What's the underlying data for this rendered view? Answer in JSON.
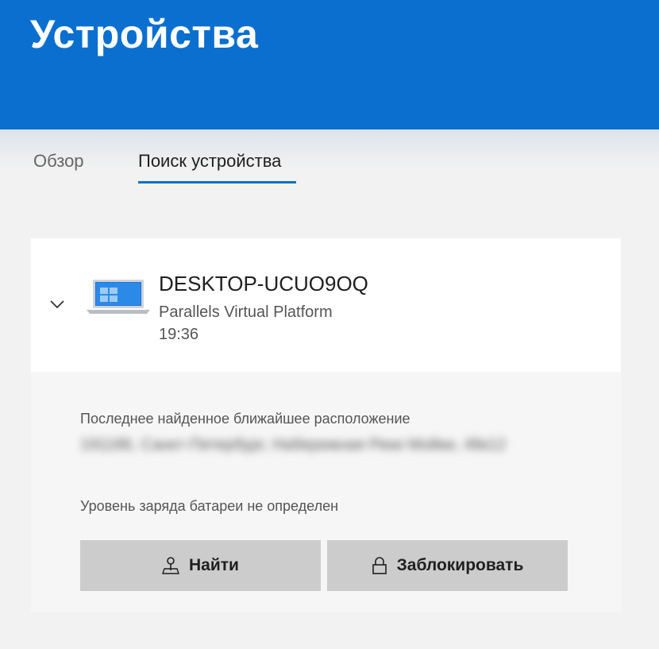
{
  "header": {
    "title": "Устройства",
    "background_color": "#0b6fcf"
  },
  "tabs": [
    {
      "label": "Обзор",
      "selected": false
    },
    {
      "label": "Поиск устройства",
      "selected": true
    }
  ],
  "device": {
    "icon": "laptop-icon",
    "name": "DESKTOP-UCUO9OQ",
    "model": "Parallels Virtual Platform",
    "time": "19:36",
    "expanded": true
  },
  "details": {
    "location_label": "Последнее найденное ближайшее расположение",
    "location_value": "191186, Санкт-Петербург, Набережная Реки Мойки, 48к12",
    "battery_text": "Уровень заряда батареи не определен"
  },
  "actions": {
    "find": {
      "label": "Найти",
      "icon": "map-pin-icon"
    },
    "lock": {
      "label": "Заблокировать",
      "icon": "lock-icon"
    }
  }
}
